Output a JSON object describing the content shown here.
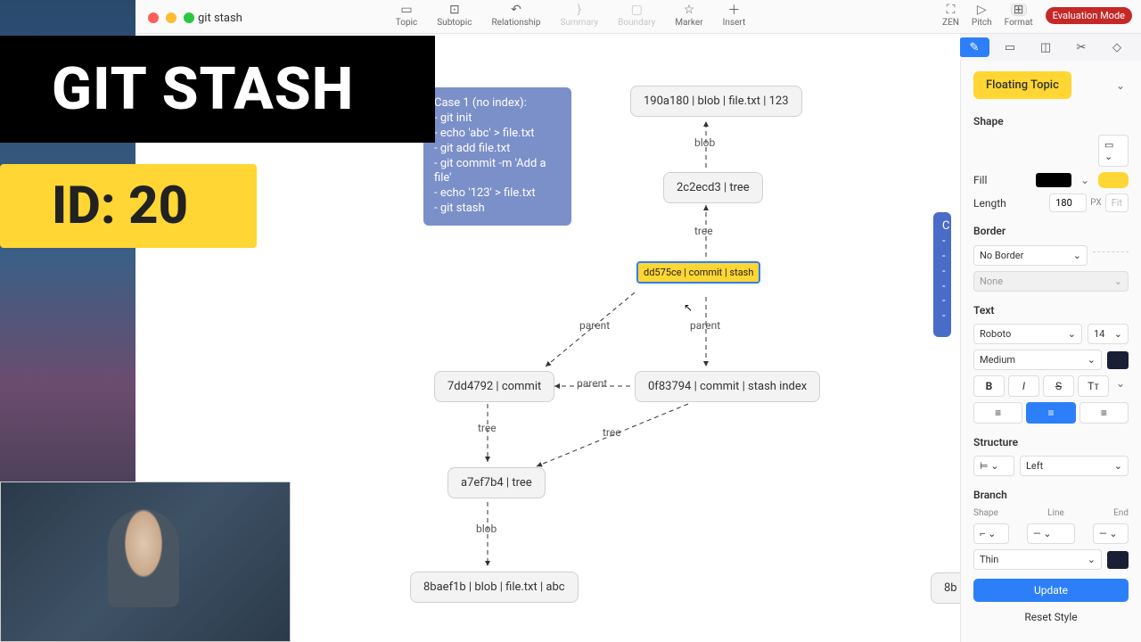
{
  "doc_title": "git stash",
  "toolbar": {
    "topic": "Topic",
    "subtopic": "Subtopic",
    "relationship": "Relationship",
    "summary": "Summary",
    "boundary": "Boundary",
    "marker": "Marker",
    "insert": "Insert",
    "zen": "ZEN",
    "pitch": "Pitch",
    "format": "Format",
    "eval": "Evaluation Mode"
  },
  "overlay": {
    "title": "GIT STASH",
    "id": "ID: 20"
  },
  "note": {
    "title": "Case 1 (no index):",
    "l1": "- git init",
    "l2": "- echo 'abc' > file.txt",
    "l3": "- git add file.txt",
    "l4": "- git commit -m 'Add a file'",
    "l5": "- echo '123' > file.txt",
    "l6": "- git stash"
  },
  "note2": "C\n-\n-\n-\n-\n-\n-",
  "nodes": {
    "blob1": "190a180 | blob | file.txt | 123",
    "tree1": "2c2ecd3 | tree",
    "stash": "dd575ce | commit | stash",
    "commit": "7dd4792 | commit",
    "stashidx": "0f83794 | commit | stash index",
    "tree2": "a7ef7b4 | tree",
    "blob2": "8baef1b | blob | file.txt | abc",
    "blob3": "8b"
  },
  "edges": {
    "blob": "blob",
    "tree": "tree",
    "parent": "parent"
  },
  "panel": {
    "floating": "Floating Topic",
    "shape": "Shape",
    "fill": "Fill",
    "length": "Length",
    "length_val": "180",
    "px": "PX",
    "fit": "Fit",
    "border": "Border",
    "border_sel": "No Border",
    "border_style": "None",
    "text": "Text",
    "font": "Roboto",
    "size": "14",
    "weight": "Medium",
    "b": "B",
    "i": "I",
    "s": "S",
    "tt": "Tᴛ",
    "structure": "Structure",
    "struct_dir": "Left",
    "branch": "Branch",
    "b_shape": "Shape",
    "b_line": "Line",
    "b_end": "End",
    "thin": "Thin",
    "update": "Update",
    "reset": "Reset Style"
  }
}
